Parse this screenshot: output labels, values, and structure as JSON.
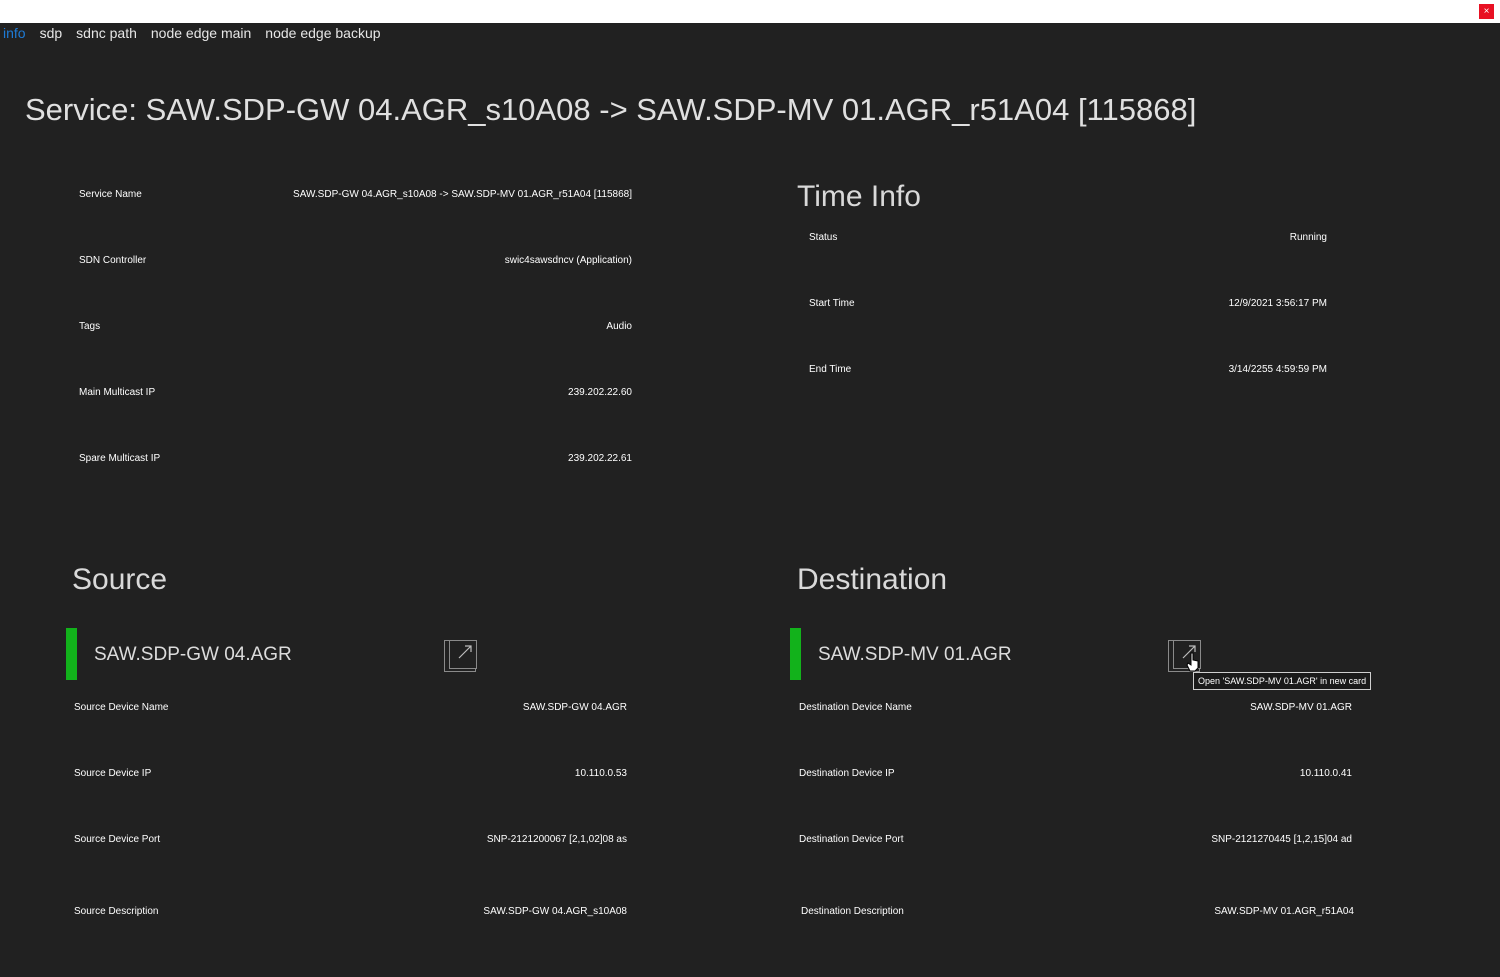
{
  "window": {
    "close_label": "×"
  },
  "tabs": [
    {
      "label": "info",
      "active": true
    },
    {
      "label": "sdp"
    },
    {
      "label": "sdnc path"
    },
    {
      "label": "node edge main"
    },
    {
      "label": "node edge backup"
    }
  ],
  "page_title": "Service: SAW.SDP-GW 04.AGR_s10A08 -> SAW.SDP-MV 01.AGR_r51A04 [115868]",
  "service": {
    "rows": [
      {
        "key": "Service Name",
        "value": "SAW.SDP-GW 04.AGR_s10A08 -> SAW.SDP-MV 01.AGR_r51A04 [115868]"
      },
      {
        "key": "SDN Controller",
        "value": "swic4sawsdncv (Application)"
      },
      {
        "key": "Tags",
        "value": "Audio"
      },
      {
        "key": "Main Multicast IP",
        "value": "239.202.22.60"
      },
      {
        "key": "Spare Multicast IP",
        "value": "239.202.22.61"
      }
    ]
  },
  "time_info": {
    "heading": "Time Info",
    "rows": [
      {
        "key": "Status",
        "value": "Running"
      },
      {
        "key": "Start Time",
        "value": "12/9/2021 3:56:17 PM"
      },
      {
        "key": "End Time",
        "value": "3/14/2255 4:59:59 PM"
      }
    ]
  },
  "source": {
    "heading": "Source",
    "device_name": "SAW.SDP-GW 04.AGR",
    "status_color": "#12b21b",
    "rows": [
      {
        "key": "Source Device Name",
        "value": "SAW.SDP-GW 04.AGR"
      },
      {
        "key": "Source Device IP",
        "value": "10.110.0.53"
      },
      {
        "key": "Source Device Port",
        "value": "SNP-2121200067 [2,1,02]08 as"
      },
      {
        "key": "Source Description",
        "value": "SAW.SDP-GW 04.AGR_s10A08"
      }
    ]
  },
  "destination": {
    "heading": "Destination",
    "device_name": "SAW.SDP-MV 01.AGR",
    "status_color": "#12b21b",
    "tooltip": "Open 'SAW.SDP-MV 01.AGR' in new card",
    "rows": [
      {
        "key": "Destination Device Name",
        "value": "SAW.SDP-MV 01.AGR"
      },
      {
        "key": "Destination Device IP",
        "value": "10.110.0.41"
      },
      {
        "key": "Destination Device Port",
        "value": "SNP-2121270445 [1,2,15]04 ad"
      },
      {
        "key": "Destination Description",
        "value": "SAW.SDP-MV 01.AGR_r51A04"
      }
    ]
  }
}
